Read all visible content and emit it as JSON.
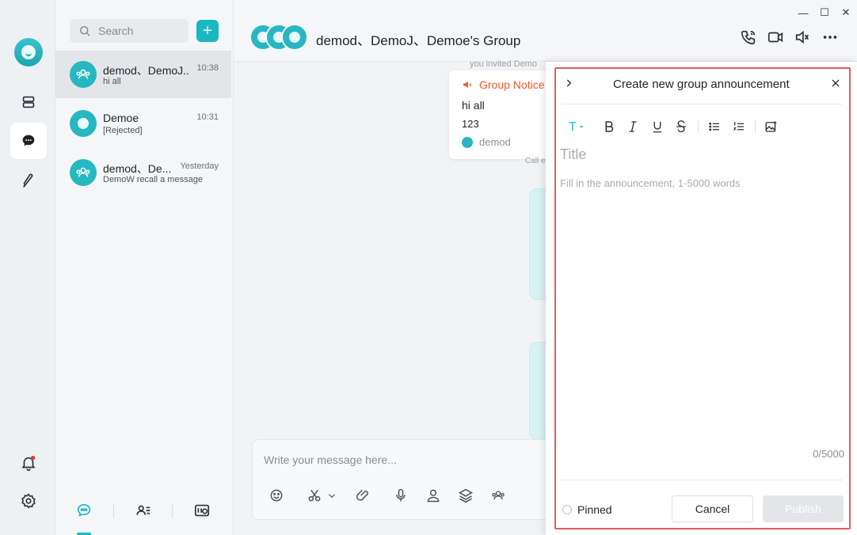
{
  "rail": {
    "items": [
      "user-avatar",
      "layers-icon",
      "chat-icon",
      "feather-icon",
      "bell-icon",
      "gear-icon"
    ]
  },
  "list": {
    "search_placeholder": "Search",
    "add_label": "+",
    "conversations": [
      {
        "name": "demod、DemoJ...",
        "time": "10:38",
        "preview": "hi all"
      },
      {
        "name": "Demoe",
        "time": "10:31",
        "preview": "[Rejected]"
      },
      {
        "name": "demod、De...",
        "time": "Yesterday",
        "preview": "DemoW recall a message"
      }
    ]
  },
  "chat": {
    "title": "demod、DemoJ、Demoe's Group",
    "invited_text": "you invited Demo",
    "call_text": "Call e",
    "notice": {
      "label": "Group Notice",
      "line1": "hi all",
      "line2": "123",
      "author": "demod"
    },
    "composer_placeholder": "Write your message here..."
  },
  "window": {
    "minimize": "—",
    "maximize": "☐",
    "close": "✕"
  },
  "panel": {
    "title": "Create new group announcement",
    "title_placeholder": "Title",
    "body_placeholder": "Fill in the announcement, 1-5000 words",
    "count": "0/5000",
    "pinned_label": "Pinned",
    "cancel_label": "Cancel",
    "publish_label": "Publish"
  },
  "colors": {
    "accent": "#1ab8c1",
    "notice": "#f05a28",
    "highlight_frame": "#e25c5c"
  }
}
